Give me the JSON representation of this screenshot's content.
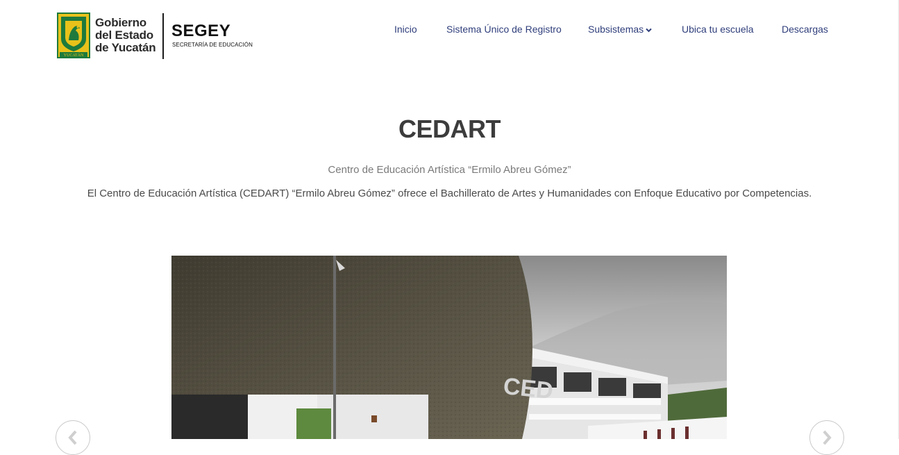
{
  "header": {
    "gov_logo": {
      "lines": [
        "Gobierno",
        "del Estado",
        "de Yucatán"
      ],
      "crest_text": "YUCATÁN"
    },
    "segey_logo": {
      "title": "SEGEY",
      "subtitle": "SECRETARÍA DE EDUCACIÓN"
    },
    "nav": [
      {
        "label": "Inicio"
      },
      {
        "label": "Sistema Único de Registro"
      },
      {
        "label": "Subsistemas",
        "icon": "chevron-down-icon"
      },
      {
        "label": "Ubica tu escuela"
      },
      {
        "label": "Descargas"
      }
    ]
  },
  "hero": {
    "title": "CEDART",
    "subtitle": "Centro de Educación Artística “Ermilo Abreu Gómez”",
    "description": "El Centro de Educación Artística (CEDART) “Ermilo Abreu Gómez” ofrece el Bachillerato de Artes y Humanidades con Enfoque Educativo por Competencias."
  },
  "carousel": {
    "building_sign": "CED",
    "prev_icon": "chevron-left-icon",
    "next_icon": "chevron-right-icon"
  },
  "colors": {
    "nav_link": "#2f3e7b",
    "title": "#3c3c3c",
    "crest_green": "#1e7a3c",
    "crest_gold": "#e8c21a"
  }
}
